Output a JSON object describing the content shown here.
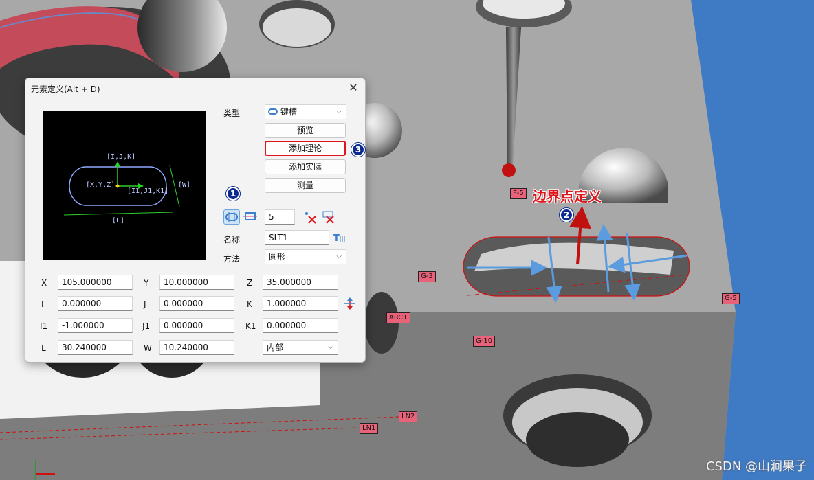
{
  "dialog": {
    "title": "元素定义(Alt + D)",
    "close_glyph": "✕",
    "preview": {
      "label_ijk": "[I,J,K]",
      "label_xyz": "[X,Y,Z]",
      "label_ijk1": "[I1,J1,K1]",
      "label_w": "[W]",
      "label_l": "[L]"
    },
    "type_label": "类型",
    "type_value": "键槽",
    "buttons": {
      "preview": "预览",
      "add_theoretical": "添加理论",
      "add_actual": "添加实际",
      "measure": "测量"
    },
    "point_count": "5",
    "name_label": "名称",
    "name_value": "SLT1",
    "method_label": "方法",
    "method_value": "圆形",
    "fields": {
      "x_label": "X",
      "x_value": "105.000000",
      "y_label": "Y",
      "y_value": "10.000000",
      "z_label": "Z",
      "z_value": "35.000000",
      "i_label": "I",
      "i_value": "0.000000",
      "j_label": "J",
      "j_value": "0.000000",
      "k_label": "K",
      "k_value": "1.000000",
      "i1_label": "I1",
      "i1_value": "-1.000000",
      "j1_label": "J1",
      "j1_value": "0.000000",
      "k1_label": "K1",
      "k1_value": "0.000000",
      "l_label": "L",
      "l_value": "30.240000",
      "w_label": "W",
      "w_value": "10.240000",
      "side_value": "内部"
    }
  },
  "annotations": {
    "callout_1": "1",
    "callout_2": "2",
    "callout_3": "3",
    "boundary_text": "边界点定义"
  },
  "scene_labels": {
    "f5": "F-5",
    "g3": "G-3",
    "g5": "G-5",
    "g10": "G-10",
    "arc1": "ARC1",
    "ln1": "LN1",
    "ln2": "LN2"
  },
  "watermark": "CSDN @山涧果子",
  "colors": {
    "annotation_red": "#e0141b",
    "callout_blue": "#0a2a8f",
    "tag_pink": "#e8637a",
    "background_blue": "#3f7ac4",
    "part_gray": "#a7a7a7"
  }
}
